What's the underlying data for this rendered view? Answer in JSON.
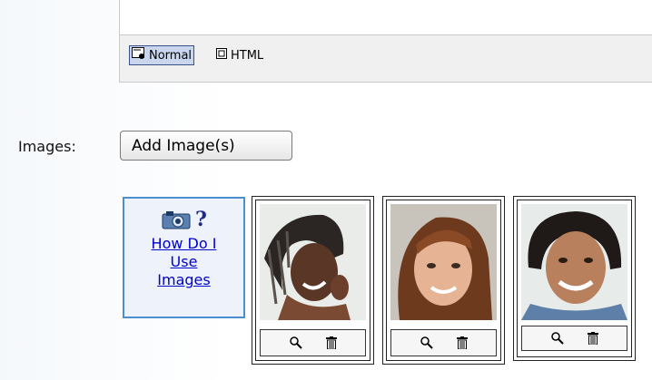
{
  "editor": {
    "modes": [
      {
        "label": "Normal",
        "icon": "normal-mode-icon",
        "selected": true
      },
      {
        "label": "HTML",
        "icon": "html-mode-icon",
        "selected": false
      }
    ]
  },
  "images_section": {
    "label": "Images:",
    "add_button_label": "Add Image(s)",
    "help": {
      "icon": "camera-question-icon",
      "link_lines": [
        "How Do I",
        "Use",
        "Images"
      ]
    },
    "images": [
      {
        "alt": "woman with braided hair",
        "actions": [
          "zoom-icon",
          "trash-icon"
        ]
      },
      {
        "alt": "smiling woman",
        "actions": [
          "zoom-icon",
          "trash-icon"
        ]
      },
      {
        "alt": "smiling man",
        "actions": [
          "zoom-icon",
          "trash-icon"
        ]
      }
    ]
  },
  "colors": {
    "link": "#0000cc",
    "help_border": "#4a8fd0",
    "help_bg": "#eef3fb",
    "mode_selected_bg": "#c9d6ee"
  }
}
